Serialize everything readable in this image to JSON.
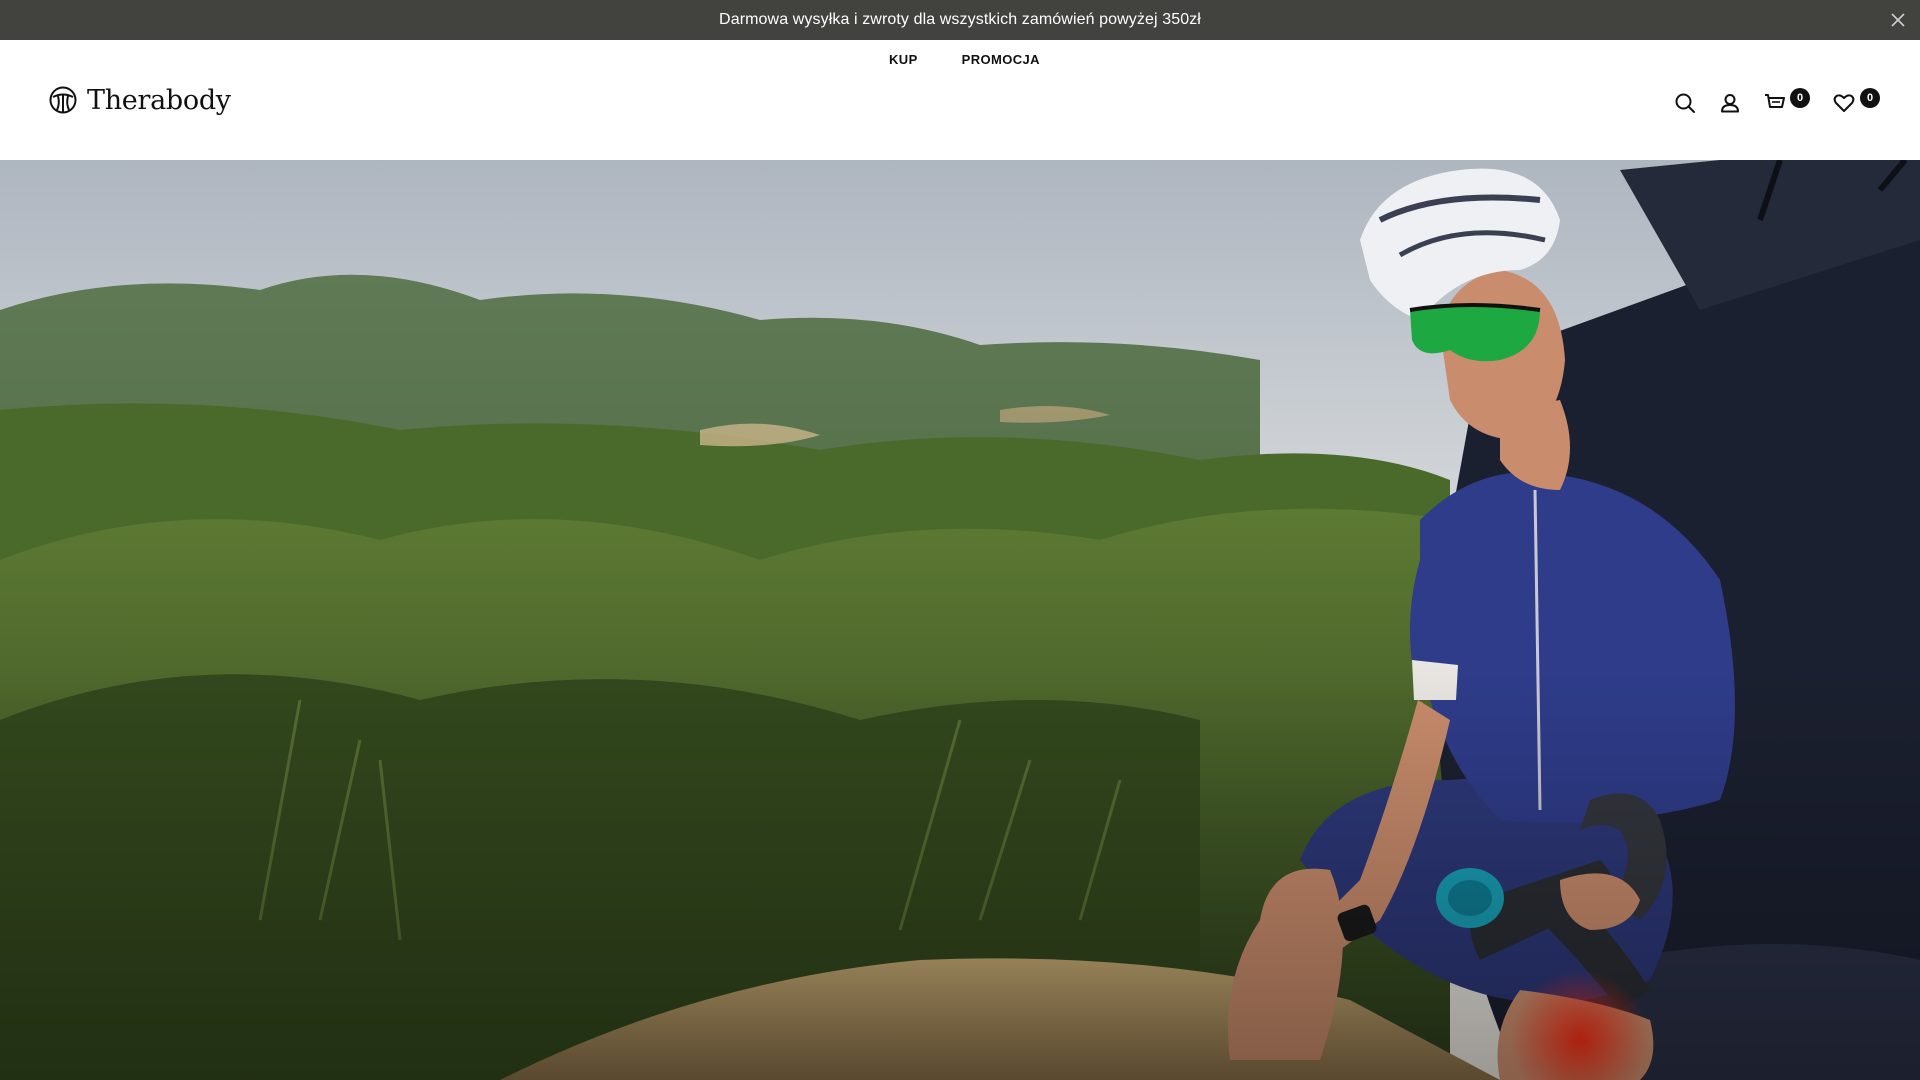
{
  "announcement": {
    "text": "Darmowa wysyłka i zwroty dla wszystkich zamówień powyżej 350zł",
    "close_icon": "close-icon"
  },
  "header": {
    "logo_text": "Therabody",
    "nav": [
      {
        "label": "KUP"
      },
      {
        "label": "PROMOCJA"
      }
    ],
    "icons": {
      "search": "search-icon",
      "account": "user-icon",
      "cart": "cart-icon",
      "wishlist": "heart-icon"
    },
    "cart_count": "0",
    "wishlist_count": "0"
  },
  "hero": {
    "image": "cyclist-with-massage-gun-on-hillside",
    "colors": {
      "sky": "#d8dce0",
      "hills": "#4f6b3a",
      "jersey": "#2e3b86",
      "ground": "#b49a6a"
    }
  }
}
